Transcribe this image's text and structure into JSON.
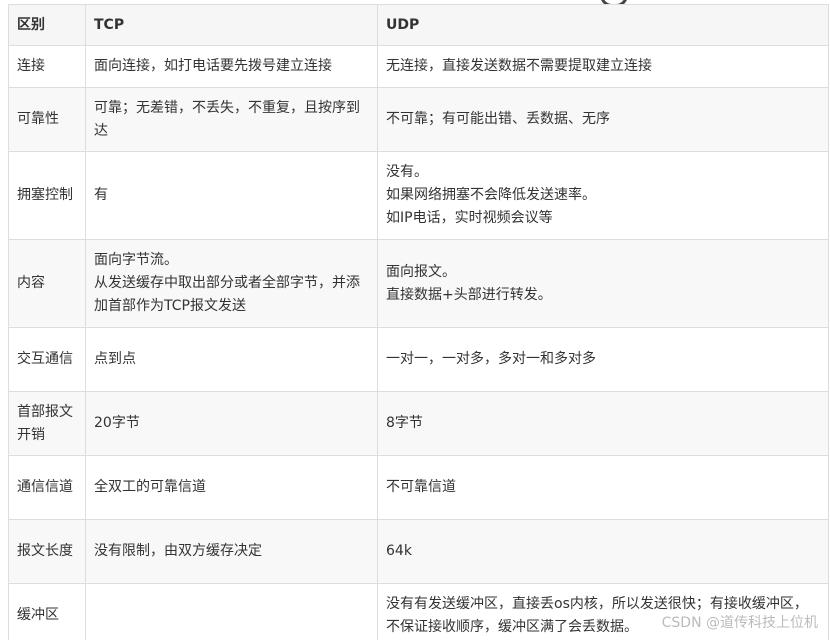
{
  "table": {
    "headers": [
      "区别",
      "TCP",
      "UDP"
    ],
    "rows": [
      {
        "label": "连接",
        "tcp": [
          "面向连接，如打电话要先拨号建立连接"
        ],
        "udp": [
          "无连接，直接发送数据不需要提取建立连接"
        ],
        "height": 42
      },
      {
        "label": "可靠性",
        "tcp": [
          "可靠；无差错，不丢失，不重复，且按序到达"
        ],
        "udp": [
          "不可靠；有可能出错、丢数据、无序"
        ],
        "height": 64
      },
      {
        "label": "拥塞控制",
        "tcp": [
          "有"
        ],
        "udp": [
          "没有。",
          "如果网络拥塞不会降低发送速率。",
          "如IP电话，实时视频会议等"
        ],
        "height": 88
      },
      {
        "label": "内容",
        "tcp": [
          "面向字节流。",
          "从发送缓存中取出部分或者全部字节，并添加首部作为TCP报文发送"
        ],
        "udp": [
          "面向报文。",
          "直接数据+头部进行转发。"
        ],
        "height": 88
      },
      {
        "label": "交互通信",
        "tcp": [
          "点到点"
        ],
        "udp": [
          "一对一，一对多，多对一和多对多"
        ],
        "height": 64
      },
      {
        "label": "首部报文开销",
        "tcp": [
          "20字节"
        ],
        "udp": [
          "8字节"
        ],
        "height": 64
      },
      {
        "label": "通信信道",
        "tcp": [
          "全双工的可靠信道"
        ],
        "udp": [
          "不可靠信道"
        ],
        "height": 64
      },
      {
        "label": "报文长度",
        "tcp": [
          "没有限制，由双方缓存决定"
        ],
        "udp": [
          "64k"
        ],
        "height": 64
      },
      {
        "label": "缓冲区",
        "tcp": [
          ""
        ],
        "udp": [
          "没有有发送缓冲区，直接丢os内核，所以发送很快；有接收缓冲区，不保证接收顺序，缓冲区满了会丢数据。"
        ],
        "height": 64
      }
    ]
  },
  "watermark": "CSDN @道传科技上位机"
}
